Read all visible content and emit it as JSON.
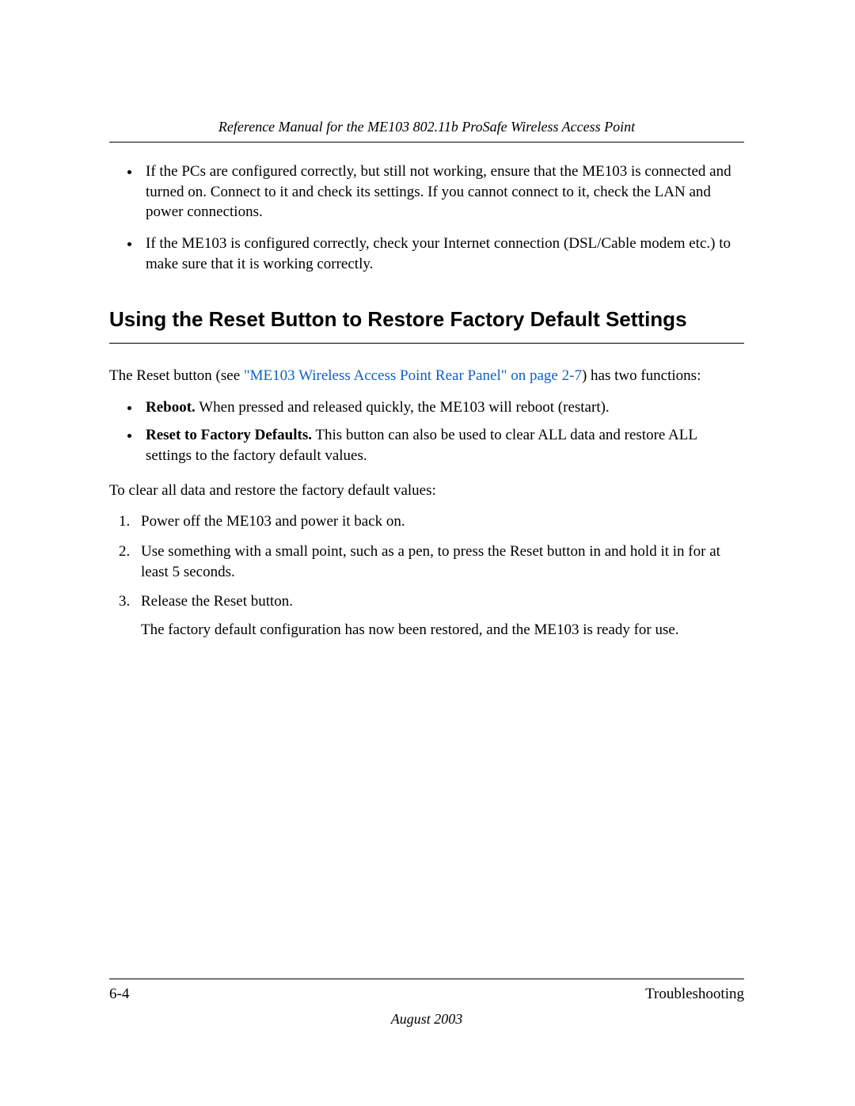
{
  "header": {
    "manual_title": "Reference Manual for the ME103 802.11b ProSafe Wireless Access Point"
  },
  "intro_bullets": [
    "If the PCs are configured correctly, but still not working, ensure that the ME103 is connected and turned on. Connect to it and check its settings. If you cannot connect to it, check the LAN and power connections.",
    "If the ME103 is configured correctly, check your Internet connection (DSL/Cable modem etc.) to make sure that it is working correctly."
  ],
  "section": {
    "heading": "Using the Reset Button to Restore Factory Default Settings",
    "intro_prefix": "The Reset button (see ",
    "intro_link": "\"ME103 Wireless Access Point Rear Panel\" on page 2-7",
    "intro_suffix": ") has two functions:",
    "functions": [
      {
        "label": "Reboot.",
        "text": "  When pressed and released quickly, the ME103 will reboot (restart)."
      },
      {
        "label": "Reset to Factory Defaults.",
        "text": "  This button can also be used to clear ALL data and restore ALL settings to the factory default values."
      }
    ],
    "steps_intro": "To clear all data and restore the factory default values:",
    "steps": [
      {
        "text": "Power off the ME103 and power it back on."
      },
      {
        "text": "Use something with a small point, such as a pen, to press the Reset button in and hold it in for at least 5 seconds."
      },
      {
        "text": "Release the Reset button.",
        "note": "The factory default configuration has now been restored, and the ME103 is ready for use."
      }
    ]
  },
  "footer": {
    "page_number": "6-4",
    "section_name": "Troubleshooting",
    "date": "August 2003"
  }
}
